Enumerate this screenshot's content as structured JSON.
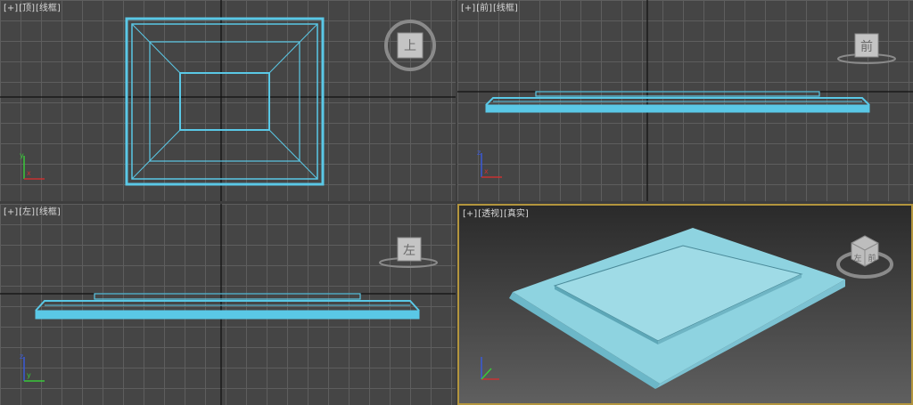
{
  "viewports": [
    {
      "id": "top",
      "label": {
        "plus": "[+]",
        "view": "[顶]",
        "mode": "[线框]"
      },
      "viewcube_face": "上"
    },
    {
      "id": "front",
      "label": {
        "plus": "[+]",
        "view": "[前]",
        "mode": "[线框]"
      },
      "viewcube_face": "前"
    },
    {
      "id": "left",
      "label": {
        "plus": "[+]",
        "view": "[左]",
        "mode": "[线框]"
      },
      "viewcube_face": "左"
    },
    {
      "id": "perspective",
      "label": {
        "plus": "[+]",
        "view": "[透视]",
        "mode": "[真实]"
      },
      "viewcube_faces": [
        "左",
        "前"
      ]
    }
  ],
  "colors": {
    "object": "#5ac8e6",
    "object_fill": "#8ed3e0",
    "grid_line": "#5e5e5e",
    "active_border": "#b3953d",
    "axis_x": "#c83232",
    "axis_y": "#3ac83a",
    "axis_z": "#3a5ad8"
  }
}
